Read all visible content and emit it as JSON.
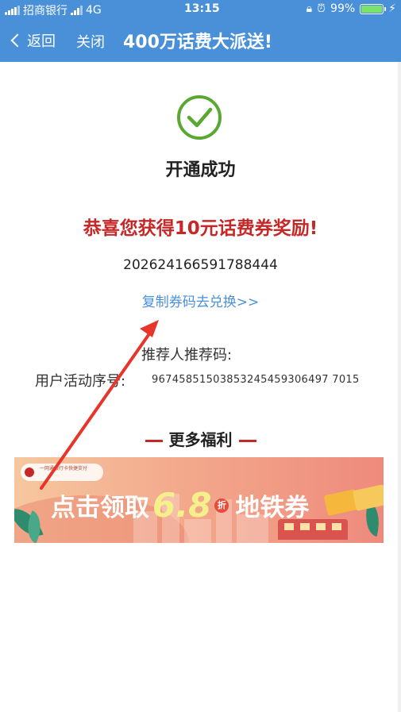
{
  "status_bar": {
    "carrier": "招商银行",
    "network": "4G",
    "time": "13:15",
    "battery": "99%"
  },
  "nav": {
    "back_label": "返回",
    "close_label": "关闭",
    "title": "400万话费大派送!"
  },
  "result": {
    "success_title": "开通成功",
    "congrats": "恭喜您获得10元话费券奖励!",
    "coupon_code": "202624166591788444",
    "copy_link": "复制券码去兑换>>",
    "referrer_label": "推荐人推荐码:",
    "activity_label": "用户活动序号:",
    "activity_value": "96745851503853245459306497 7015"
  },
  "more": {
    "title": "更多福利"
  },
  "banner": {
    "tag_text": "一网通银行卡快捷支付",
    "text_before": "点击领取",
    "number": "6.8",
    "zhe": "折",
    "text_after": "地铁券"
  },
  "colors": {
    "nav_bg": "#4a90d9",
    "success_green": "#5aa832",
    "congrats_red": "#c62828",
    "link_blue": "#4a90d9",
    "arrow_red": "#e8352b"
  }
}
